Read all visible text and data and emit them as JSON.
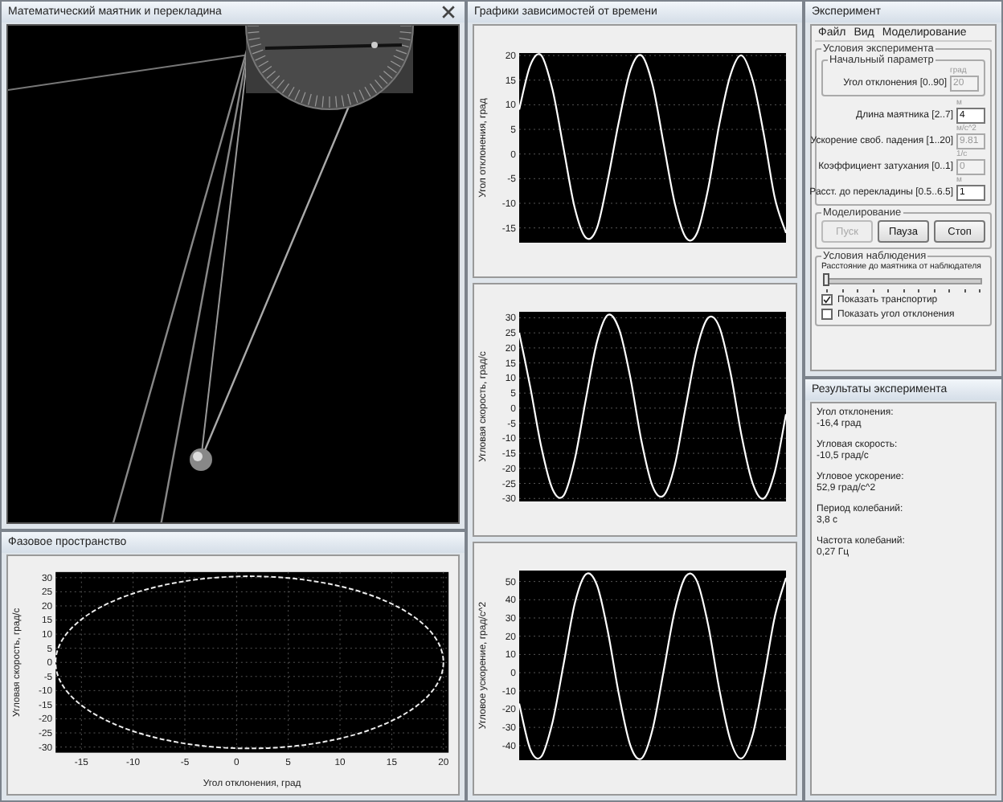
{
  "pendulum_window": {
    "title": "Математический маятник и перекладина"
  },
  "phase_window": {
    "title": "Фазовое пространство",
    "chart_data": {
      "type": "line",
      "xlabel": "Угол отклонения, град",
      "ylabel": "Угловая скорость, град/с",
      "xlim": [
        -17.5,
        20.5
      ],
      "ylim": [
        -32,
        32
      ],
      "xticks": [
        -15,
        -10,
        -5,
        0,
        5,
        10,
        15,
        20
      ],
      "yticks": [
        -30,
        -25,
        -20,
        -15,
        -10,
        -5,
        0,
        5,
        10,
        15,
        20,
        25,
        30
      ],
      "grid": true
    }
  },
  "time_window": {
    "title": "Графики зависимостей от времени",
    "charts": [
      {
        "chart_data": {
          "type": "line",
          "ylabel": "Угол отклонения, град",
          "series": [
            {
              "color": "#ffffff",
              "values": [
                9,
                18,
                20,
                13,
                1,
                -11,
                -17,
                -15,
                -5,
                7,
                17,
                20,
                14,
                2,
                -10,
                -17,
                -16,
                -7,
                6,
                16,
                20,
                15,
                4,
                -9,
                -16
              ]
            }
          ],
          "ylim": [
            -18,
            20.5
          ],
          "yticks": [
            -15,
            -10,
            -5,
            0,
            5,
            10,
            15,
            20
          ],
          "grid": true
        }
      },
      {
        "chart_data": {
          "type": "line",
          "ylabel": "Угловая скорость, град/с",
          "series": [
            {
              "color": "#ffffff",
              "values": [
                25,
                7,
                -13,
                -27,
                -29,
                -17,
                3,
                22,
                31,
                26,
                10,
                -11,
                -26,
                -29,
                -19,
                1,
                20,
                30,
                27,
                12,
                -9,
                -25,
                -30,
                -21,
                -2
              ]
            }
          ],
          "ylim": [
            -31,
            32
          ],
          "yticks": [
            -30,
            -25,
            -20,
            -15,
            -10,
            -5,
            0,
            5,
            10,
            15,
            20,
            25,
            30
          ],
          "grid": true
        }
      },
      {
        "chart_data": {
          "type": "line",
          "ylabel": "Угловое ускорение, град/с^2",
          "series": [
            {
              "color": "#ffffff",
              "values": [
                -17,
                -42,
                -46,
                -27,
                5,
                38,
                54,
                48,
                22,
                -13,
                -40,
                -47,
                -31,
                1,
                34,
                53,
                50,
                26,
                -9,
                -37,
                -47,
                -34,
                -3,
                31,
                52
              ]
            }
          ],
          "ylim": [
            -48,
            56
          ],
          "yticks": [
            -40,
            -30,
            -20,
            -10,
            0,
            10,
            20,
            30,
            40,
            50
          ],
          "grid": true
        }
      }
    ]
  },
  "experiment_window": {
    "title": "Эксперимент",
    "menu": [
      "Файл",
      "Вид",
      "Моделирование"
    ],
    "conditions": {
      "title": "Условия эксперимента",
      "initial": {
        "title": "Начальный параметр",
        "field": {
          "label": "Угол отклонения [0..90]",
          "unit": "град",
          "value": "20",
          "disabled": true
        }
      },
      "fields": [
        {
          "label": "Длина маятника [2..7]",
          "unit": "м",
          "value": "4",
          "disabled": false
        },
        {
          "label": "Ускорение своб. падения [1..20]",
          "unit": "м/с^2",
          "value": "9.81",
          "disabled": true
        },
        {
          "label": "Коэффициент затухания [0..1]",
          "unit": "1/с",
          "value": "0",
          "disabled": true
        },
        {
          "label": "Расст. до перекладины [0.5..6.5]",
          "unit": "м",
          "value": "1",
          "disabled": false
        }
      ]
    },
    "modeling": {
      "title": "Моделирование",
      "buttons": [
        {
          "label": "Пуск",
          "disabled": true
        },
        {
          "label": "Пауза",
          "disabled": false
        },
        {
          "label": "Стоп",
          "disabled": false
        }
      ]
    },
    "observation": {
      "title": "Условия наблюдения",
      "slider": {
        "label": "Расстояние до маятника от наблюдателя",
        "level": 0
      },
      "checkboxes": [
        {
          "label": "Показать транспортир",
          "checked": true
        },
        {
          "label": "Показать угол отклонения",
          "checked": false
        }
      ]
    }
  },
  "results_window": {
    "title": "Результаты эксперимента",
    "items": [
      {
        "label": "Угол отклонения:",
        "value": "-16,4 град"
      },
      {
        "label": "Угловая скорость:",
        "value": "-10,5 град/с"
      },
      {
        "label": "Угловое ускорение:",
        "value": "52,9 град/с^2"
      },
      {
        "label": "Период колебаний:",
        "value": "3,8 с"
      },
      {
        "label": "Частота колебаний:",
        "value": "0,27 Гц"
      }
    ]
  }
}
